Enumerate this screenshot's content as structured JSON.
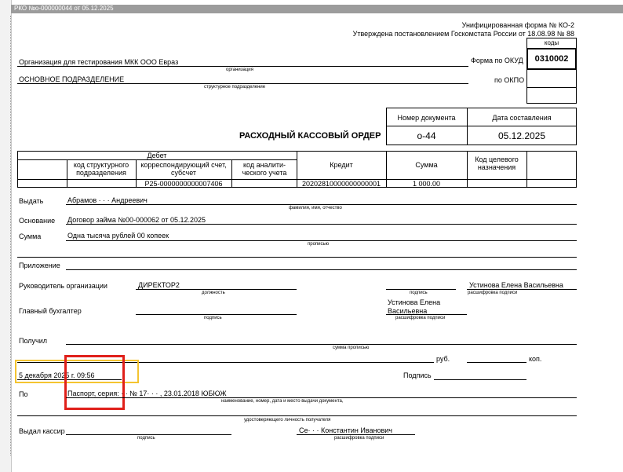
{
  "window": {
    "title": "РКО №о-000000044 от 05.12.2025"
  },
  "header": {
    "form_name": "Унифицированная форма № КО-2",
    "approved": "Утверждена постановлением Госкомстата России от 18.08.98 № 88",
    "codes_label": "коды",
    "okud_label": "Форма по ОКУД",
    "okud_code": "0310002",
    "okpo_label": "по ОКПО",
    "organization": "Организация для тестирования МКК ООО Евраз",
    "organization_caption": "организация",
    "department": "ОСНОВНОЕ ПОДРАЗДЕЛЕНИЕ",
    "department_caption": "структурное подразделение"
  },
  "doc": {
    "number_header": "Номер документа",
    "date_header": "Дата составления",
    "title": "РАСХОДНЫЙ КАССОВЫЙ ОРДЕР",
    "number": "о-44",
    "date": "05.12.2025"
  },
  "table": {
    "debit": "Дебет",
    "col_struct": "код структурного подразделения",
    "col_corr": "корреспондирующий счет, субсчет",
    "col_analytic": "код аналити-ческого учета",
    "col_credit": "Кредит",
    "col_sum": "Сумма",
    "col_purpose": "Код целевого назначения",
    "corr_value": "Р25-0000000000007406",
    "credit_value": "20202810000000000001",
    "sum_value": "1 000.00"
  },
  "fields": {
    "issue_label": "Выдать",
    "issue_value": "Абрамов ·  ·  ·  Андреевич",
    "issue_caption": "фамилия, имя, отчество",
    "basis_label": "Основание",
    "basis_value": "Договор займа №00-000062 от 05.12.2025",
    "amount_label": "Сумма",
    "amount_value": "Одна тысяча рублей 00 копеек",
    "amount_caption": "прописью",
    "attachment_label": "Приложение",
    "head_label": "Руководитель организации",
    "head_position": "ДИРЕКТОР2",
    "position_caption": "должность",
    "signature_caption": "подпись",
    "head_name": "Устинова Елена Васильевна",
    "decode_caption": "расшифровка подписи",
    "chief_label": "Главный бухгалтер",
    "chief_name_1": "Устинова Елена",
    "chief_name_2": "Васильевна",
    "received_label": "Получил",
    "received_caption": "сумма прописью",
    "rub_label": "руб.",
    "kop_label": "коп.",
    "date_value": "5 декабря 2025 г. 09:56",
    "sign_label": "Подпись",
    "by_label": "По",
    "passport_value": "Паспорт, серия:  ·  ·  № 17·  ·  ·  , 23.01.2018 ЮБЮЖ",
    "doc_caption": "наименование, номер, дата и место выдачи документа,",
    "identity_caption": "удостоверяющего личность получателя",
    "cashier_label": "Выдал кассир",
    "cashier_name": "Се·  ·  · Константин Иванович"
  },
  "colors": {
    "highlight_yellow": "#f4c430",
    "highlight_red": "#e0201a",
    "titlebar": "#9c9c9c"
  }
}
